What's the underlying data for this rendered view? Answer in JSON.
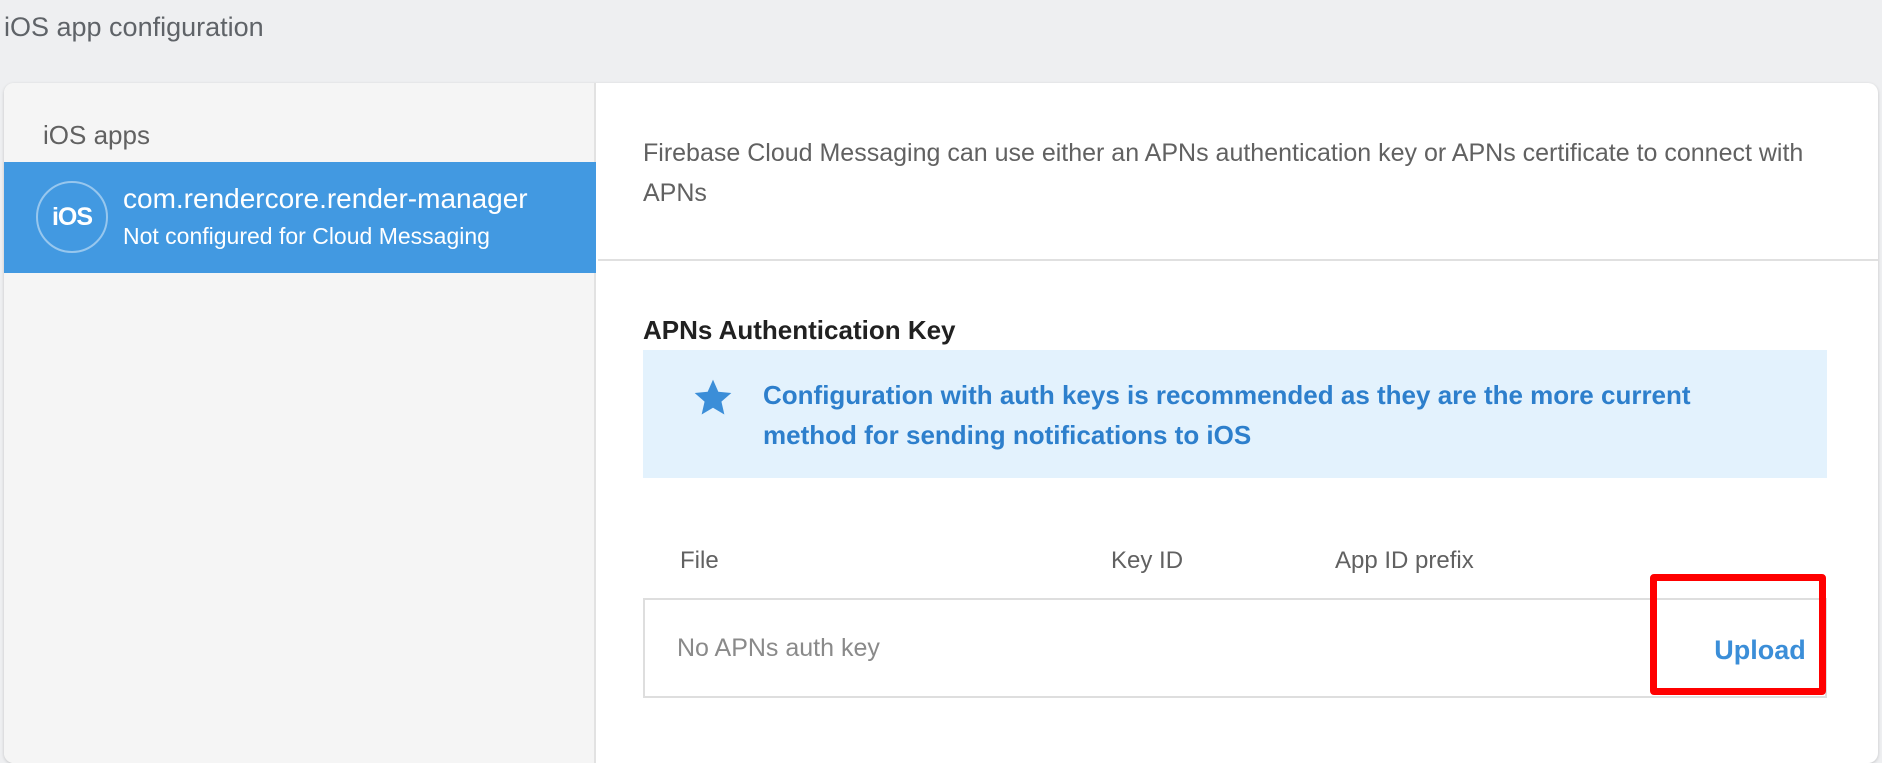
{
  "page": {
    "title": "iOS app configuration"
  },
  "sidebar": {
    "heading": "iOS apps",
    "apps": [
      {
        "avatar_text": "iOS",
        "name": "com.rendercore.render-manager",
        "status": "Not configured for Cloud Messaging",
        "selected": true
      }
    ]
  },
  "main": {
    "intro_text": "Firebase Cloud Messaging can use either an APNs authentication key or APNs certificate to connect with APNs",
    "section_title": "APNs Authentication Key",
    "notice": {
      "icon": "star-icon",
      "text": "Configuration with auth keys is recommended as they are the more current method for sending notifications to iOS"
    },
    "table": {
      "headers": [
        "File",
        "Key ID",
        "App ID prefix"
      ],
      "empty_text": "No APNs auth key",
      "upload_label": "Upload"
    }
  },
  "colors": {
    "accent": "#4299e1",
    "link": "#3b8ed8",
    "notice_bg": "#e3f2fd",
    "notice_text": "#2d7fcc",
    "highlight": "#ff0000",
    "page_bg": "#eeeff1"
  }
}
